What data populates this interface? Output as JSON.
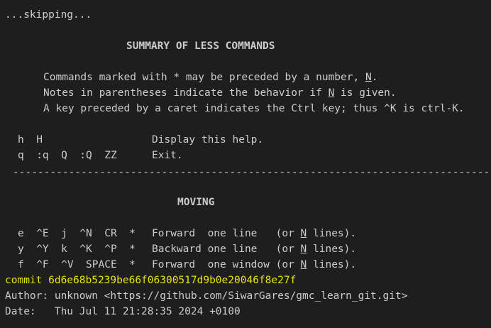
{
  "terminal": {
    "top_mark": "^",
    "skipping": "...skipping...",
    "help_title": "SUMMARY OF LESS COMMANDS",
    "intro": {
      "line1_pre": "Commands marked with * may be preceded by a number, ",
      "line1_n": "N",
      "line1_post": ".",
      "line2_pre": "Notes in parentheses indicate the behavior if ",
      "line2_n": "N",
      "line2_post": " is given.",
      "line3": "A key preceded by a caret indicates the Ctrl key; thus ^K is ctrl-K."
    },
    "general": [
      {
        "keys": "h  H",
        "desc": "Display this help."
      },
      {
        "keys": "q  :q  Q  :Q  ZZ",
        "desc": "Exit."
      }
    ],
    "rule": "----------------------------------------------------------------------------------------------------------------",
    "moving_title": "MOVING",
    "moving": [
      {
        "keys": "e  ^E  j  ^N  CR  *",
        "action": "Forward ",
        "what": "one line  ",
        "paren_pre": "(or ",
        "n": "N",
        "paren_post": " lines)."
      },
      {
        "keys": "y  ^Y  k  ^K  ^P  *",
        "action": "Backward",
        "what": "one line  ",
        "paren_pre": "(or ",
        "n": "N",
        "paren_post": " lines)."
      },
      {
        "keys": "f  ^F  ^V  SPACE  *",
        "action": "Forward ",
        "what": "one window",
        "paren_pre": "(or ",
        "n": "N",
        "paren_post": " lines)."
      }
    ],
    "commit_line": "commit 6d6e68b5239be66f06300517d9b0e20046f8e27f",
    "author_line": "Author: unknown <https://github.com/SiwarGares/gmc_learn_git.git>",
    "date_line": "Date:   Thu Jul 11 21:28:35 2024 +0100"
  },
  "colors": {
    "background": "#1e1e1e",
    "text": "#cccccc",
    "commit": "#e5e510"
  }
}
